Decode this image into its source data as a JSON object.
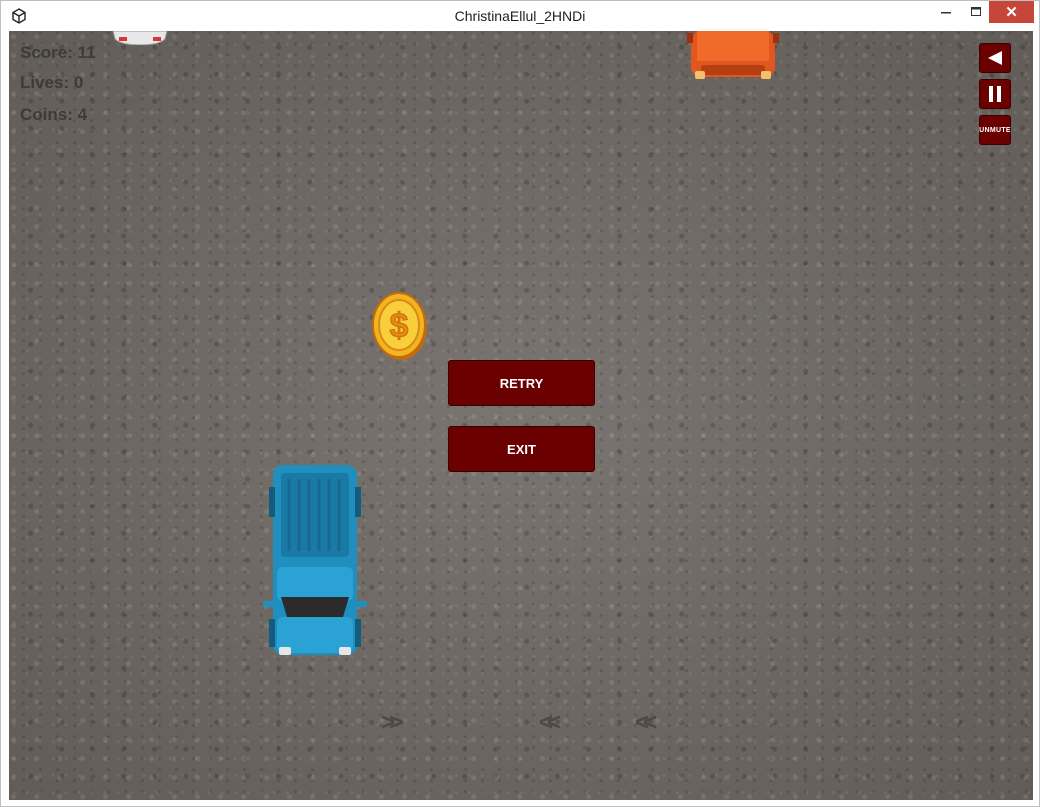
{
  "window": {
    "title": "ChristinaEllul_2HNDi",
    "minimize_icon": "minimize-icon",
    "maximize_icon": "maximize-icon",
    "close_icon": "close-icon",
    "close_glyph": "✕"
  },
  "hud": {
    "score": "Score: 11",
    "lives": "Lives: 0",
    "coins": "Coins: 4"
  },
  "controls": {
    "back_icon": "back-triangle-icon",
    "pause_icon": "pause-icon",
    "unmute_label": "UNMUTE"
  },
  "menu": {
    "retry_label": "RETRY",
    "exit_label": "EXIT"
  },
  "sprites": {
    "player": "blue-pickup-truck",
    "enemy_1": "orange-car",
    "enemy_2": "white-car",
    "coin": "dollar-coin"
  },
  "road_markings": [
    ">>",
    "<<",
    "<<"
  ],
  "colors": {
    "button_bg": "#6b0000",
    "hud_text": "#3d3a38",
    "close_button": "#c7463a",
    "road": "#6e6a66"
  }
}
